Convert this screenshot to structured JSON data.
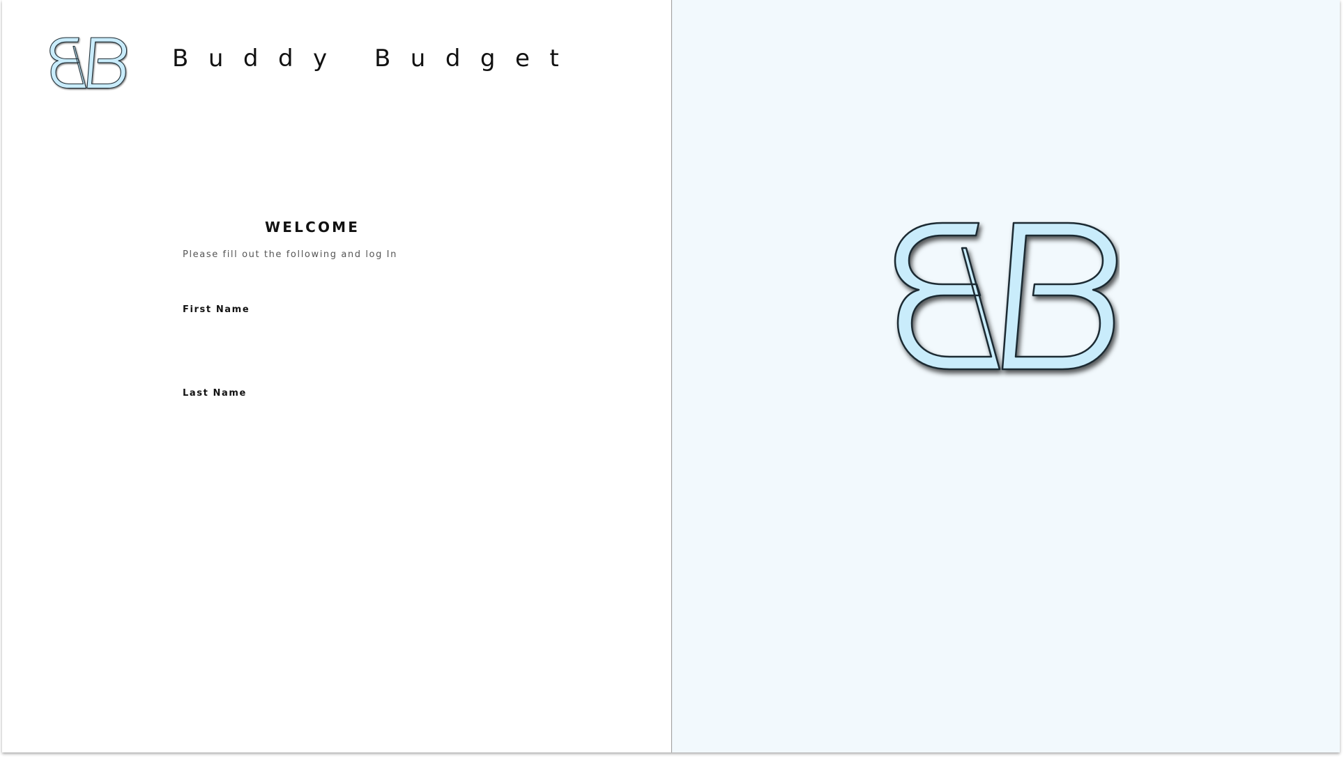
{
  "brand": {
    "name": "Buddy Budget",
    "logo_icon": "bb-monogram-logo-icon",
    "logo_fill": "#c9ecfb",
    "logo_stroke": "#1a2a33"
  },
  "form": {
    "heading": "WELCOME",
    "subtitle": "Please fill out the following and log In",
    "first_name": {
      "label": "First Name",
      "value": "",
      "placeholder": ""
    },
    "last_name": {
      "label": "Last Name",
      "value": "",
      "placeholder": ""
    }
  },
  "hero": {
    "logo_icon": "bb-monogram-logo-icon",
    "background": "#f2f9fd"
  }
}
